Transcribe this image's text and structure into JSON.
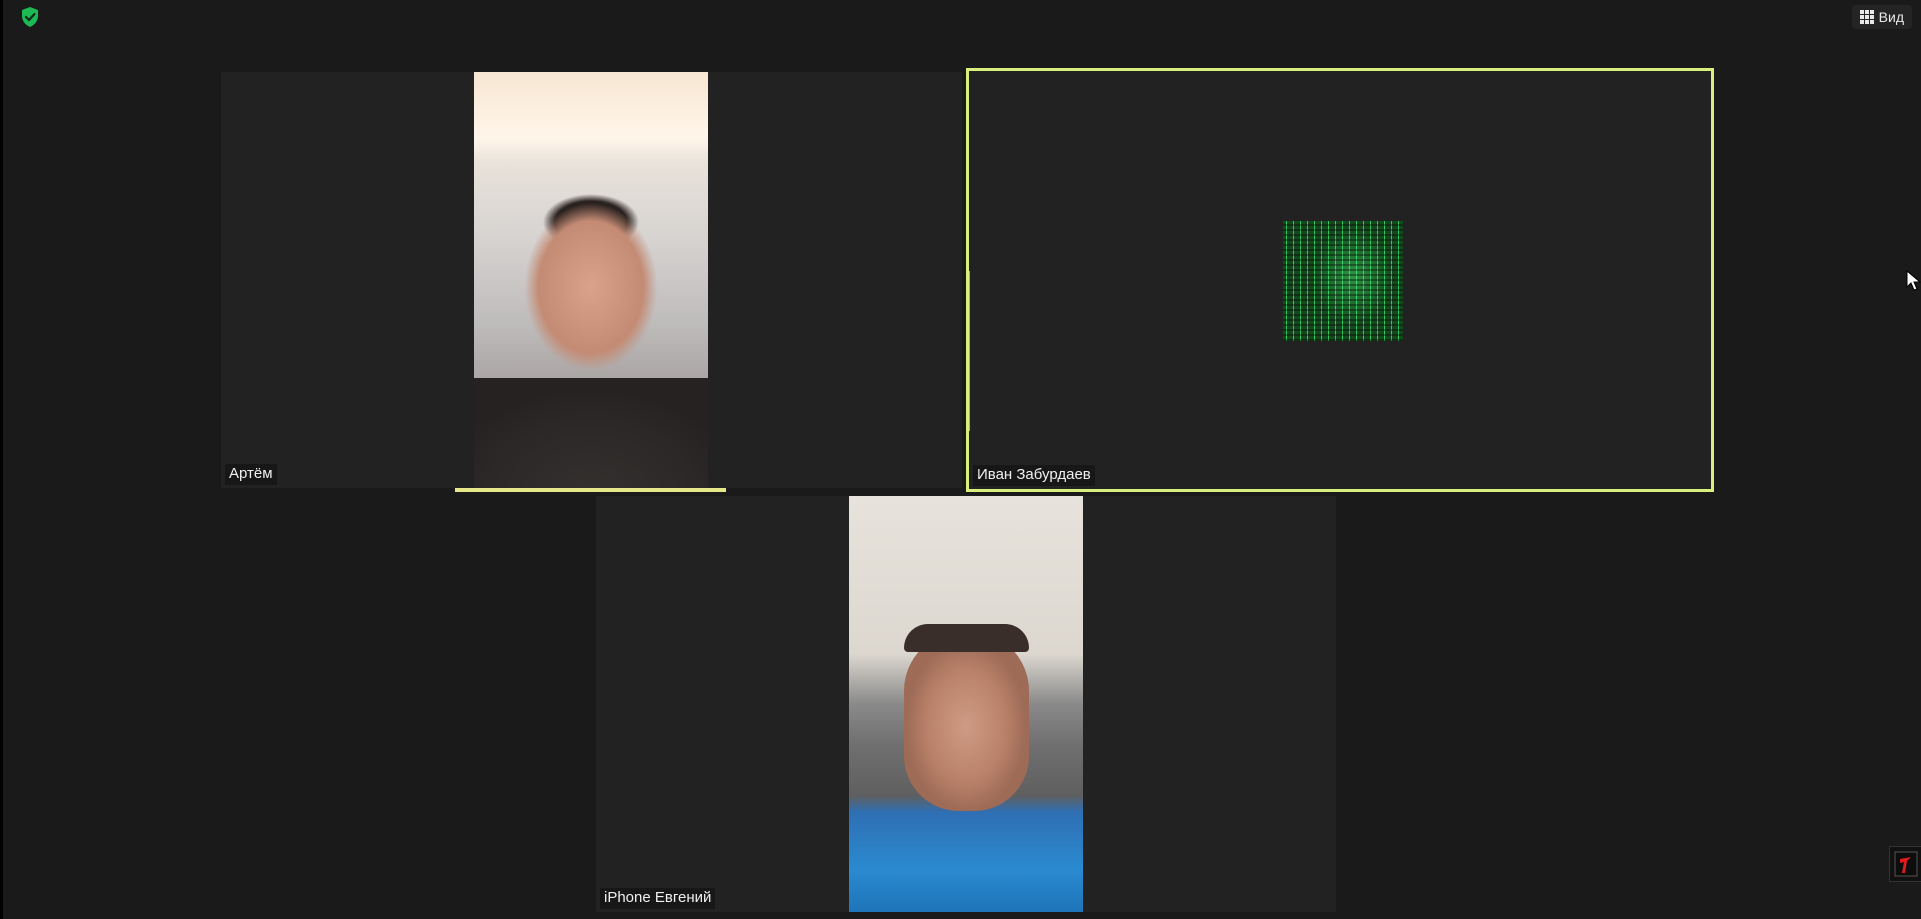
{
  "window": {
    "background_color": "#1a1a1a",
    "tile_background_color": "#222222",
    "active_speaker_border_color": "#d9ef7c"
  },
  "topbar": {
    "security_icon": "shield-check-icon",
    "security_icon_color": "#1db954",
    "view_button": {
      "label": "Вид",
      "icon": "grid-icon"
    }
  },
  "participants": [
    {
      "name": "Артём",
      "video": "camera-on",
      "speaking_indicator": true
    },
    {
      "name": "Иван Забурдаев",
      "video": "avatar",
      "active_speaker": true
    },
    {
      "name": "iPhone Евгений",
      "video": "camera-on"
    }
  ],
  "overlays": {
    "cursor_icon": "mouse-pointer-icon",
    "corner_app_icon": "app-badge-icon"
  }
}
